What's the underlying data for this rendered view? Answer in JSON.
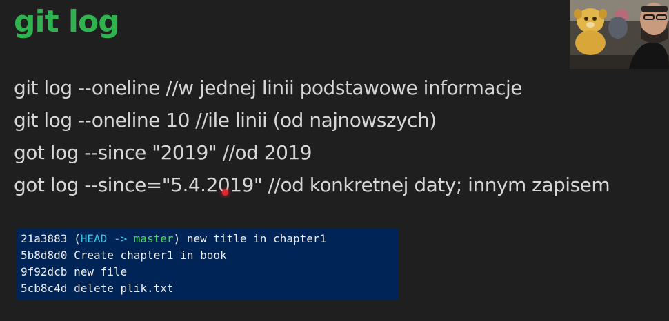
{
  "slide": {
    "title": "git log",
    "commands": [
      "git log --oneline //w jednej linii podstawowe informacje",
      "git log --oneline 10 //ile linii (od najnowszych)",
      "got log --since \"2019\" //od 2019",
      "got log --since=\"5.4.2019\" //od konkretnej daty; innym zapisem"
    ]
  },
  "terminal": {
    "lines": [
      {
        "hash": "21a3883",
        "open_paren": " (",
        "head": "HEAD",
        "arrow": " -> ",
        "branch": "master",
        "close_paren": ")",
        "message": " new title in chapter1"
      },
      {
        "text": "5b8d8d0 Create chapter1 in book"
      },
      {
        "text": "9f92dcb new file"
      },
      {
        "text": "5cb8c4d delete plik.txt"
      }
    ],
    "colors": {
      "background": "#012456",
      "head": "#3ec6e6",
      "branch": "#3fdc4f",
      "text": "#eeeeee"
    }
  },
  "colors": {
    "background": "#1f1f1f",
    "title": "#2fb34f",
    "body_text": "#d6d6d6",
    "cursor": "#e0262e"
  }
}
